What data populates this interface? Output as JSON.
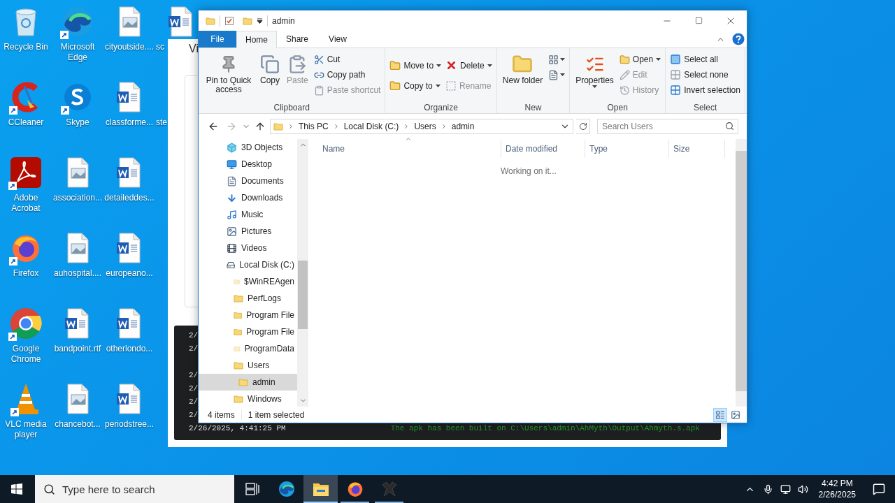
{
  "desktop_icons": [
    {
      "label": "Recycle Bin",
      "kind": "app",
      "shortcut": false
    },
    {
      "label": "CCleaner",
      "kind": "app",
      "shortcut": true
    },
    {
      "label": "Adobe Acrobat",
      "kind": "app",
      "shortcut": true
    },
    {
      "label": "Firefox",
      "kind": "app",
      "shortcut": true
    },
    {
      "label": "Google Chrome",
      "kind": "app",
      "shortcut": true
    },
    {
      "label": "VLC media player",
      "kind": "app",
      "shortcut": true
    },
    {
      "label": "Microsoft Edge",
      "kind": "app",
      "shortcut": true
    },
    {
      "label": "Skype",
      "kind": "app",
      "shortcut": true
    },
    {
      "label": "association...",
      "kind": "image",
      "shortcut": false
    },
    {
      "label": "auhospital....",
      "kind": "image",
      "shortcut": false
    },
    {
      "label": "bandpoint.rtf",
      "kind": "word",
      "shortcut": false
    },
    {
      "label": "chancebot...",
      "kind": "image",
      "shortcut": false
    },
    {
      "label": "cityoutside....",
      "kind": "image",
      "shortcut": false
    },
    {
      "label": "classforme...",
      "kind": "word",
      "shortcut": false
    },
    {
      "label": "detaileddes...",
      "kind": "word",
      "shortcut": false
    },
    {
      "label": "europeano...",
      "kind": "word",
      "shortcut": false
    },
    {
      "label": "otherlondo...",
      "kind": "word",
      "shortcut": false
    },
    {
      "label": "periodstree...",
      "kind": "word",
      "shortcut": false
    },
    {
      "label": "sc",
      "kind": "word",
      "shortcut": false
    },
    {
      "label": "ste",
      "kind": "covered"
    }
  ],
  "background_window": {
    "heading": "Vi",
    "terminal_lines": [
      {
        "kind": "entry",
        "time": "2/"
      },
      {
        "kind": "entry",
        "time": "2/"
      },
      {
        "kind": "blank"
      },
      {
        "kind": "entry",
        "time": "2/"
      },
      {
        "kind": "entry",
        "time": "2/"
      },
      {
        "kind": "entry",
        "time": "2/"
      },
      {
        "kind": "entry",
        "time": "2/"
      },
      {
        "kind": "entry",
        "time": "2/26/2025, 4:41:25 PM",
        "message": "The apk has been built on C:\\Users\\admin\\AhMyth\\Output\\Ahmyth.s.apk"
      }
    ]
  },
  "explorer": {
    "title": "admin",
    "tabs": [
      {
        "label": "File",
        "kind": "file",
        "selected": false
      },
      {
        "label": "Home",
        "kind": "tab",
        "selected": true
      },
      {
        "label": "Share",
        "kind": "tab",
        "selected": false
      },
      {
        "label": "View",
        "kind": "tab",
        "selected": false
      }
    ],
    "ribbon_groups": [
      {
        "label": "Clipboard",
        "items": [
          {
            "label": "Pin to Quick access",
            "kind": "large",
            "disabled": false,
            "dropdown": false
          },
          {
            "label": "Copy",
            "kind": "large",
            "disabled": false,
            "dropdown": false
          },
          {
            "label": "Paste",
            "kind": "large",
            "disabled": true,
            "dropdown": false
          },
          {
            "label": "Cut",
            "kind": "small",
            "disabled": false,
            "dropdown": false
          },
          {
            "label": "Copy path",
            "kind": "small",
            "disabled": false,
            "dropdown": false
          },
          {
            "label": "Paste shortcut",
            "kind": "small",
            "disabled": true,
            "dropdown": false
          }
        ]
      },
      {
        "label": "Organize",
        "items": [
          {
            "label": "Move to",
            "kind": "medium",
            "disabled": false,
            "dropdown": true
          },
          {
            "label": "Copy to",
            "kind": "medium",
            "disabled": false,
            "dropdown": true
          },
          {
            "label": "Delete",
            "kind": "medium",
            "disabled": false,
            "dropdown": true
          },
          {
            "label": "Rename",
            "kind": "medium",
            "disabled": true,
            "dropdown": false
          }
        ]
      },
      {
        "label": "New",
        "items": [
          {
            "label": "New folder",
            "kind": "large",
            "disabled": false,
            "dropdown": false
          },
          {
            "kind": "icon",
            "disabled": false,
            "dropdown": true
          },
          {
            "kind": "icon",
            "disabled": false,
            "dropdown": true
          }
        ]
      },
      {
        "label": "Open",
        "items": [
          {
            "label": "Properties",
            "kind": "large",
            "disabled": false,
            "dropdown": true
          },
          {
            "label": "Open",
            "kind": "small",
            "disabled": false,
            "dropdown": true
          },
          {
            "label": "Edit",
            "kind": "small",
            "disabled": true,
            "dropdown": false
          },
          {
            "label": "History",
            "kind": "small",
            "disabled": true,
            "dropdown": false
          }
        ]
      },
      {
        "label": "Select",
        "items": [
          {
            "label": "Select all",
            "kind": "small",
            "disabled": false,
            "dropdown": false
          },
          {
            "label": "Select none",
            "kind": "small",
            "disabled": false,
            "dropdown": false
          },
          {
            "label": "Invert selection",
            "kind": "small",
            "disabled": false,
            "dropdown": false
          }
        ]
      }
    ],
    "breadcrumbs": [
      "This PC",
      "Local Disk (C:)",
      "Users",
      "admin"
    ],
    "search": {
      "placeholder": "Search Users"
    },
    "nav_items": [
      {
        "label": "3D Objects",
        "kind": "objects",
        "selected": false
      },
      {
        "label": "Desktop",
        "kind": "desktop",
        "selected": false
      },
      {
        "label": "Documents",
        "kind": "documents",
        "selected": false
      },
      {
        "label": "Downloads",
        "kind": "downloads",
        "selected": false
      },
      {
        "label": "Music",
        "kind": "music",
        "selected": false
      },
      {
        "label": "Pictures",
        "kind": "pictures",
        "selected": false
      },
      {
        "label": "Videos",
        "kind": "videos",
        "selected": false
      },
      {
        "label": "Local Disk (C:)",
        "kind": "drive",
        "selected": false,
        "children": [
          {
            "label": "$WinREAgen",
            "kind": "folder",
            "hidden": true,
            "selected": false
          },
          {
            "label": "PerfLogs",
            "kind": "folder",
            "hidden": false,
            "selected": false
          },
          {
            "label": "Program File",
            "kind": "folder",
            "hidden": false,
            "selected": false
          },
          {
            "label": "Program File",
            "kind": "folder",
            "hidden": false,
            "selected": false
          },
          {
            "label": "ProgramData",
            "kind": "folder",
            "hidden": true,
            "selected": false
          },
          {
            "label": "Users",
            "kind": "folder",
            "hidden": false,
            "selected": false,
            "children": [
              {
                "label": "admin",
                "kind": "folder",
                "hidden": false,
                "selected": true
              }
            ]
          },
          {
            "label": "Windows",
            "kind": "folder",
            "hidden": false,
            "selected": false
          }
        ]
      }
    ],
    "columns": [
      {
        "label": "Name",
        "sorted": true
      },
      {
        "label": "Date modified",
        "sorted": false
      },
      {
        "label": "Type",
        "sorted": false
      },
      {
        "label": "Size",
        "sorted": false
      }
    ],
    "content_message": "Working on it...",
    "status": {
      "item_count": "4 items",
      "selection": "1 item selected"
    },
    "views": [
      {
        "kind": "details",
        "selected": true
      },
      {
        "kind": "large_icons",
        "selected": false
      }
    ]
  },
  "taskbar": {
    "search": {
      "placeholder": "Type here to search"
    },
    "apps": [
      {
        "kind": "taskview",
        "running": false,
        "active": false
      },
      {
        "kind": "edge",
        "running": false,
        "active": false
      },
      {
        "kind": "explorer",
        "running": true,
        "active": true
      },
      {
        "kind": "firefox",
        "running": true,
        "active": false
      },
      {
        "kind": "app",
        "running": true,
        "active": false
      }
    ],
    "time": "4:42 PM",
    "date": "2/26/2025"
  }
}
